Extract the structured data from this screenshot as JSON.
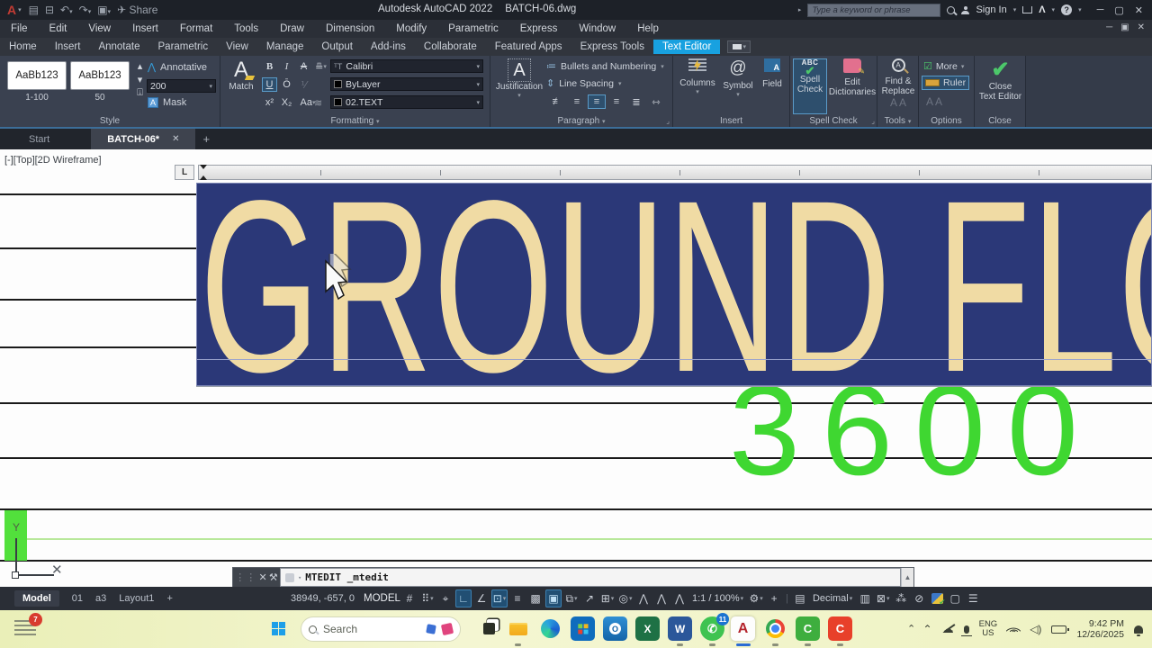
{
  "title_bar": {
    "share": "Share",
    "app_title": "Autodesk AutoCAD 2022",
    "doc_title": "BATCH-06.dwg",
    "search_placeholder": "Type a keyword or phrase",
    "sign_in": "Sign In"
  },
  "menu": {
    "items": [
      "File",
      "Edit",
      "View",
      "Insert",
      "Format",
      "Tools",
      "Draw",
      "Dimension",
      "Modify",
      "Parametric",
      "Express",
      "Window",
      "Help"
    ]
  },
  "ribbon_tabs": {
    "items": [
      "Home",
      "Insert",
      "Annotate",
      "Parametric",
      "View",
      "Manage",
      "Output",
      "Add-ins",
      "Collaborate",
      "Featured Apps",
      "Express Tools",
      "Text Editor"
    ]
  },
  "ribbon": {
    "style": {
      "label": "Style",
      "preview": "AaBb123",
      "style1_name": "1-100",
      "style2_name": "50",
      "annotative": "Annotative",
      "text_height": "200",
      "mask": "Mask"
    },
    "formatting": {
      "label": "Formatting",
      "match": "Match",
      "font": "Calibri",
      "color": "ByLayer",
      "layer": "02.TEXT"
    },
    "paragraph": {
      "label": "Paragraph",
      "justification": "Justification",
      "bullets": "Bullets and Numbering",
      "line_spacing": "Line Spacing"
    },
    "insert": {
      "label": "Insert",
      "columns": "Columns",
      "symbol": "Symbol",
      "field": "Field"
    },
    "spell": {
      "label": "Spell Check",
      "spell1": "Spell",
      "spell2": "Check",
      "dict1": "Edit",
      "dict2": "Dictionaries"
    },
    "tools": {
      "label": "Tools",
      "find1": "Find &",
      "find2": "Replace"
    },
    "options": {
      "label": "Options",
      "more": "More",
      "ruler": "Ruler"
    },
    "close": {
      "label": "Close",
      "close1": "Close",
      "close2": "Text Editor"
    }
  },
  "doc_tabs": {
    "start": "Start",
    "active": "BATCH-06*"
  },
  "viewport": {
    "view_controls": "[-][Top][2D Wireframe]",
    "mtext": "GROUND FLO",
    "dimension": "3600",
    "ucs_y": "Y"
  },
  "command": {
    "text": "MTEDIT _mtedit"
  },
  "status": {
    "model": "Model",
    "t01": "01",
    "ta3": "a3",
    "layout1": "Layout1",
    "coords": "38949, -657, 0",
    "space": "MODEL",
    "scale": "1:1 / 100%",
    "units": "Decimal"
  },
  "taskbar": {
    "badge": "7",
    "search": "Search",
    "whatsapp_badge": "11",
    "lang1": "ENG",
    "lang2": "US",
    "time": "9:42 PM",
    "date": "12/26/2025"
  },
  "colors": {
    "accent_blue": "#18a1e0",
    "mtext_bg": "#2b3878",
    "mtext_text": "#f0dba4",
    "dim_green": "#3fd731"
  }
}
